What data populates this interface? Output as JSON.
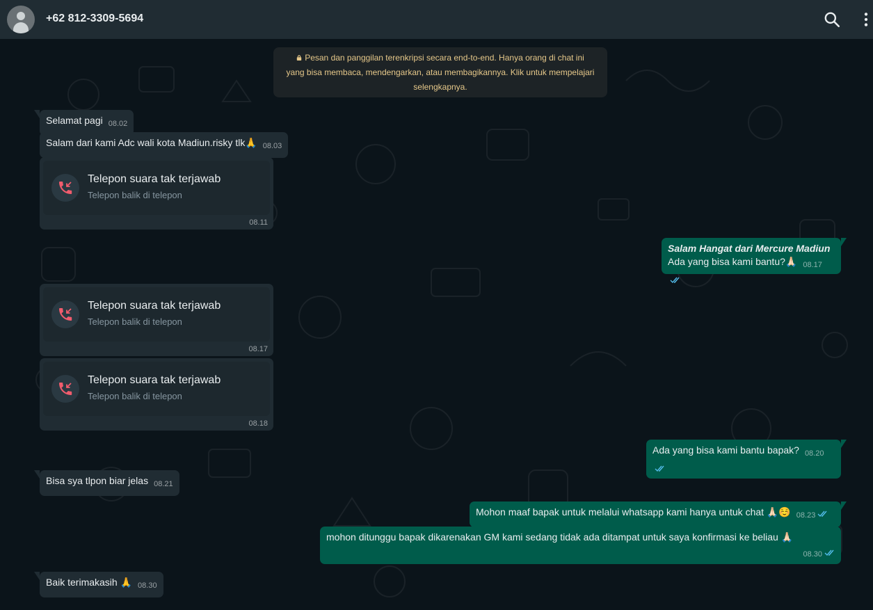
{
  "header": {
    "contact_name": "+62 812-3309-5694",
    "icons": [
      "avatar",
      "search-icon",
      "menu-icon"
    ]
  },
  "notice": {
    "text": "Pesan dan panggilan terenkripsi secara end-to-end. Hanya orang di chat ini yang bisa membaca, mendengarkan, atau membagikannya. Klik untuk mempelajari selengkapnya.",
    "line1": "Pesan dan panggilan terenkripsi secara end-to-end. Hanya orang di chat ini",
    "line2": "yang bisa membaca, mendengarkan, atau membagikannya. Klik untuk mempelajari",
    "line3": "selengkapnya."
  },
  "messages": [
    {
      "dir": "in",
      "text": "Selamat pagi",
      "time": "08.02"
    },
    {
      "dir": "in",
      "text": "Salam dari kami Adc wali kota Madiun.risky tlk🙏",
      "time": "08.03"
    },
    {
      "dir": "in",
      "type": "call",
      "title": "Telepon suara tak terjawab",
      "sub": "Telepon balik di telepon",
      "time": "08.11"
    },
    {
      "dir": "out",
      "title": "Salam Hangat dari Mercure Madiun",
      "text": "Ada yang bisa kami bantu?🙏🏻",
      "time": "08.17"
    },
    {
      "dir": "in",
      "type": "call",
      "title": "Telepon suara tak terjawab",
      "sub": "Telepon balik di telepon",
      "time": "08.17"
    },
    {
      "dir": "in",
      "type": "call",
      "title": "Telepon suara tak terjawab",
      "sub": "Telepon balik di telepon",
      "time": "08.18"
    },
    {
      "dir": "out",
      "text": "Ada yang bisa kami bantu bapak?",
      "time": "08.20"
    },
    {
      "dir": "in",
      "text": "Bisa sya tlpon biar jelas",
      "time": "08.21"
    },
    {
      "dir": "out",
      "text": "Mohon maaf bapak untuk melalui whatsapp kami hanya untuk chat 🙏🏻☺️",
      "time": "08.23"
    },
    {
      "dir": "out",
      "text": "mohon ditunggu bapak dikarenakan GM kami sedang tidak ada ditampat untuk saya konfirmasi ke beliau 🙏🏻",
      "time": "08.30"
    },
    {
      "dir": "in",
      "text": "Baik terimakasih 🙏",
      "time": "08.30"
    }
  ],
  "colors": {
    "background": "#0b141a",
    "header": "#202c33",
    "incoming": "#202c33",
    "outgoing": "#005c4b",
    "missed_call": "#f15c6d",
    "read_ticks": "#53bdeb",
    "notice_text": "#e6c88a"
  }
}
